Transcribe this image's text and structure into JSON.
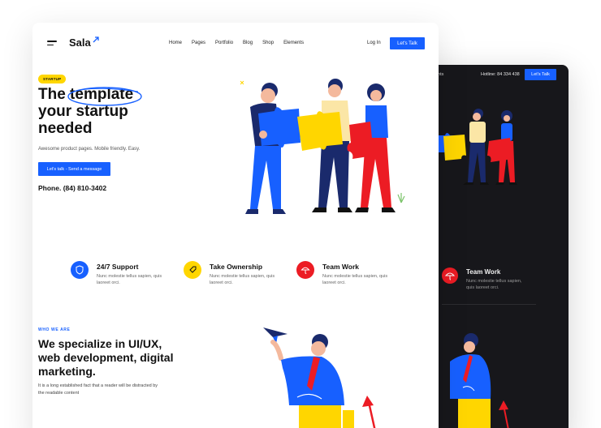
{
  "dark_preview": {
    "nav_partial": "ents",
    "hotline": "Hotline: 84 334 438",
    "cta_label": "Let's Talk",
    "feature": {
      "title": "Team Work",
      "desc": "Nunc molestie tellus sapien, quis laoreet orci."
    }
  },
  "nav": {
    "logo": "Sala",
    "menu": [
      "Home",
      "Pages",
      "Portfolio",
      "Blog",
      "Shop",
      "Elements"
    ],
    "login": "Log In",
    "cta_label": "Let's Talk"
  },
  "hero": {
    "badge": "STARTUP",
    "headline": "The template your startup needed",
    "subtitle": "Awesome product pages. Mobile friendly. Easy.",
    "cta_label": "Let's talk - Send a message",
    "phone": "Phone. (84) 810-3402"
  },
  "features": [
    {
      "title": "24/7 Support",
      "desc": "Nunc molestie tellus sapien, quis laoreet orci.",
      "icon": "shield-icon",
      "color": "#1760ff"
    },
    {
      "title": "Take Ownership",
      "desc": "Nunc molestie tellus sapien, quis laoreet orci.",
      "icon": "tag-icon",
      "color": "#ffd600"
    },
    {
      "title": "Team Work",
      "desc": "Nunc molestie tellus sapien, quis laoreet orci.",
      "icon": "umbrella-icon",
      "color": "#ec1c24"
    }
  ],
  "section2": {
    "eyebrow": "WHO WE ARE",
    "heading": "We specialize in UI/UX, web development, digital marketing.",
    "body": "It is a long established fact that a reader will be distracted by the readable content"
  },
  "colors": {
    "accent": "#1760ff",
    "yellow": "#ffd600",
    "red": "#ec1c24",
    "dark": "#17171b"
  }
}
